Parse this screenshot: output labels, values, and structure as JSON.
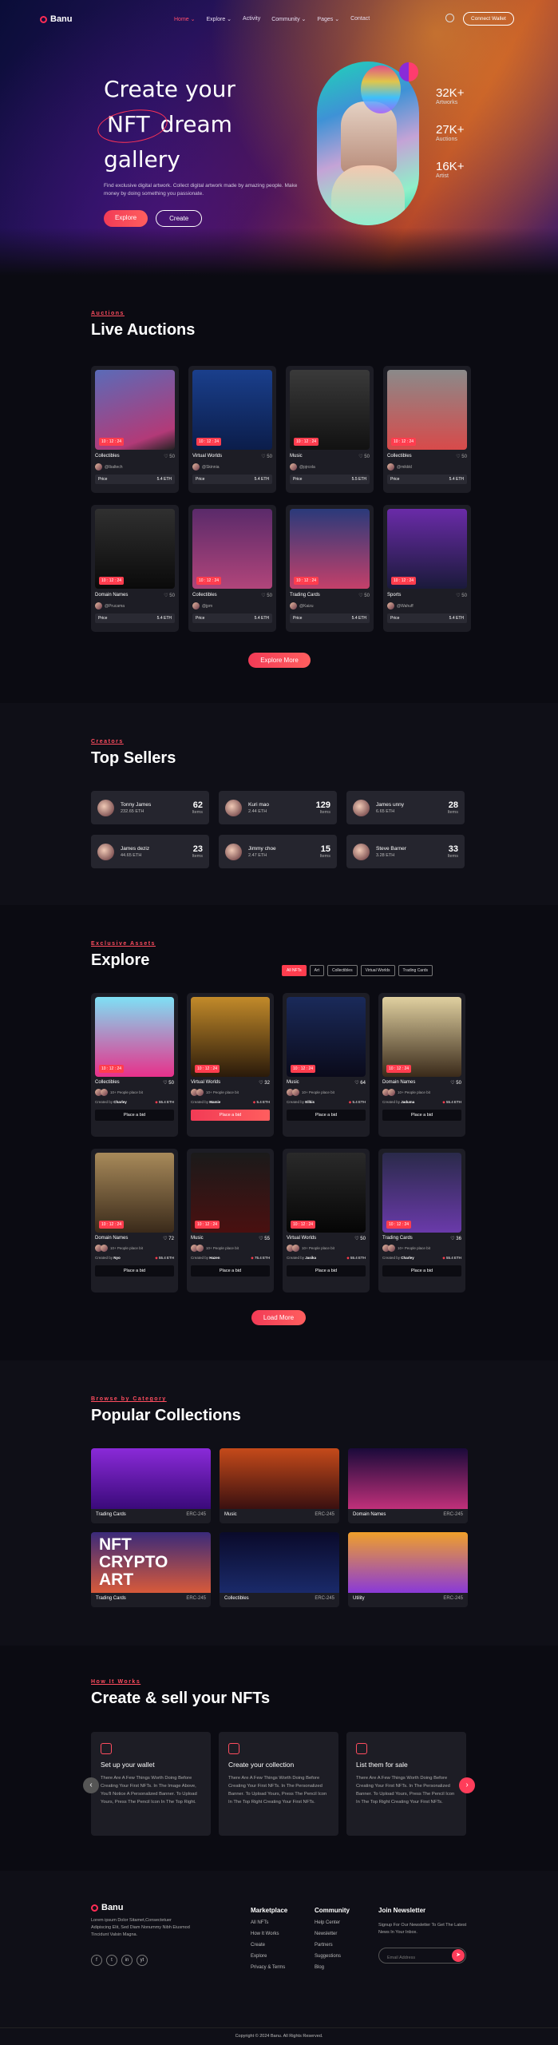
{
  "header": {
    "brand": "Banu",
    "nav": [
      "Home ⌄",
      "Explore ⌄",
      "Activity",
      "Community ⌄",
      "Pages ⌄",
      "Contact"
    ],
    "wallet": "Connect Wallet"
  },
  "hero": {
    "title_1": "Create your",
    "title_2a": "NFT",
    "title_2b": "dream",
    "title_3": "gallery",
    "desc": "Find exclusive digital artwork. Collect digital artwork made by amazing people. Make money by doing something you passionate.",
    "btn_explore": "Explore",
    "btn_create": "Create",
    "stats": [
      {
        "n": "32K+",
        "l": "Artworks"
      },
      {
        "n": "27K+",
        "l": "Auctions"
      },
      {
        "n": "16K+",
        "l": "Artist"
      }
    ]
  },
  "auctions": {
    "kicker": "Auctions",
    "title": "Live Auctions",
    "price_label": "Price",
    "cta": "Explore More",
    "items": [
      {
        "cat": "Collectibles",
        "likes": "♡ 50",
        "owner": "@Ibaltech",
        "price": "5.4 ETH",
        "timer": "10 : 12 : 24"
      },
      {
        "cat": "Virtual Worlds",
        "likes": "♡ 50",
        "owner": "@Skinnia",
        "price": "5.4 ETH",
        "timer": "10 : 12 : 24"
      },
      {
        "cat": "Music",
        "likes": "♡ 50",
        "owner": "@pjrcola",
        "price": "5.5 ETH",
        "timer": "10 : 12 : 24"
      },
      {
        "cat": "Collectibles",
        "likes": "♡ 50",
        "owner": "@mikkkl",
        "price": "5.4 ETH",
        "timer": "10 : 12 : 24"
      },
      {
        "cat": "Domain Names",
        "likes": "♡ 50",
        "owner": "@Prucama",
        "price": "5.4 ETH",
        "timer": "10 : 12 : 24"
      },
      {
        "cat": "Collectibles",
        "likes": "♡ 50",
        "owner": "@jpm",
        "price": "5.4 ETH",
        "timer": "10 : 12 : 24"
      },
      {
        "cat": "Trading Cards",
        "likes": "♡ 50",
        "owner": "@Kaizu",
        "price": "5.4 ETH",
        "timer": "10 : 12 : 24"
      },
      {
        "cat": "Sports",
        "likes": "♡ 50",
        "owner": "@Wahuff",
        "price": "5.4 ETH",
        "timer": "10 : 12 : 24"
      }
    ]
  },
  "sellers": {
    "kicker": "Creators",
    "title": "Top Sellers",
    "items_label": "Items",
    "items": [
      {
        "name": "Tonny James",
        "eth": "232.65 ETH",
        "count": "62"
      },
      {
        "name": "Kuri mao",
        "eth": "2.44 ETH",
        "count": "129"
      },
      {
        "name": "James unny",
        "eth": "6.65 ETH",
        "count": "28"
      },
      {
        "name": "James deziz",
        "eth": "44.65 ETH",
        "count": "23"
      },
      {
        "name": "Jimmy choe",
        "eth": "2.47 ETH",
        "count": "15"
      },
      {
        "name": "Steve Barner",
        "eth": "3.28 ETH",
        "count": "33"
      }
    ]
  },
  "explore": {
    "kicker": "Exclusive Assets",
    "title": "Explore",
    "tabs": [
      "All NFTs",
      "Art",
      "Collectibles",
      "Virtual Worlds",
      "Trading Cards"
    ],
    "people": "10+ People place bit",
    "created_by": "Created by",
    "bid": "Place a bid",
    "cta": "Load More",
    "items": [
      {
        "cat": "Collectibles",
        "likes": "♡ 50",
        "creator": "Charley",
        "price": "55.4 ETH",
        "timer": "10 : 12 : 24"
      },
      {
        "cat": "Virtual Worlds",
        "likes": "♡ 32",
        "creator": "Mamie",
        "price": "5.4 ETH",
        "timer": "10 : 12 : 24"
      },
      {
        "cat": "Music",
        "likes": "♡ 64",
        "creator": "Ellkis",
        "price": "5.4 ETH",
        "timer": "10 : 12 : 24"
      },
      {
        "cat": "Domain Names",
        "likes": "♡ 50",
        "creator": "Jaduma",
        "price": "55.4 ETH",
        "timer": "10 : 12 : 24"
      },
      {
        "cat": "Domain Names",
        "likes": "♡ 72",
        "creator": "Nyo",
        "price": "55.4 ETH",
        "timer": "10 : 12 : 24"
      },
      {
        "cat": "Music",
        "likes": "♡ 55",
        "creator": "Hazen",
        "price": "75.4 ETH",
        "timer": "10 : 12 : 24"
      },
      {
        "cat": "Virtual Worlds",
        "likes": "♡ 50",
        "creator": "Jasika",
        "price": "55.4 ETH",
        "timer": "10 : 12 : 24"
      },
      {
        "cat": "Trading Cards",
        "likes": "♡ 36",
        "creator": "Charley",
        "price": "55.4 ETH",
        "timer": "10 : 12 : 24"
      }
    ]
  },
  "collections": {
    "kicker": "Browse by Category",
    "title": "Popular Collections",
    "nft_text": "NFT CRYPTO ART",
    "items": [
      {
        "name": "Trading Cards",
        "count": "ERC-245"
      },
      {
        "name": "Music",
        "count": "ERC-245"
      },
      {
        "name": "Domain Names",
        "count": "ERC-245"
      },
      {
        "name": "Trading Cards",
        "count": "ERC-245"
      },
      {
        "name": "Collectibles",
        "count": "ERC-245"
      },
      {
        "name": "Utility",
        "count": "ERC-245"
      }
    ]
  },
  "how": {
    "kicker": "How It Works",
    "title": "Create & sell your NFTs",
    "items": [
      {
        "title": "Set up your wallet",
        "text": "There Are A Few Things Worth Doing Before Creating Your First NFTs. In The Image Above, You'll Notice A Personalized Banner. To Upload Yours, Press The Pencil Icon In The Top Right."
      },
      {
        "title": "Create your collection",
        "text": "There Are A Few Things Worth Doing Before Creating Your First NFTs. In The Personalized Banner. To Upload Yours, Press The Pencil Icon In The Top Right Creating Your First NFTs."
      },
      {
        "title": "List them for sale",
        "text": "There Are A Few Things Worth Doing Before Creating Your First NFTs. In The Personalized Banner. To Upload Yours, Press The Pencil Icon In The Top Right Creating Your First NFTs."
      }
    ]
  },
  "footer": {
    "brand": "Banu",
    "about": "Lorem ipsum Dolor Sitamet,Consectetuer Adipiscing Elit, Sed Diam Nonummy Nibh Eiusmod Tincidunt Valsin Magna.",
    "socials": [
      "f",
      "t",
      "in",
      "yt"
    ],
    "cols": [
      {
        "title": "Marketplace",
        "links": [
          "All NFTs",
          "How It Works",
          "Create",
          "Explore",
          "Privacy & Terms"
        ]
      },
      {
        "title": "Community",
        "links": [
          "Help Center",
          "Newsletter",
          "Partners",
          "Suggestions",
          "Blog"
        ]
      }
    ],
    "newsletter": {
      "title": "Join Newsletter",
      "text": "Signup For Our Newsletter To Get The Latest News In Your Inbox.",
      "placeholder": "Email Address"
    },
    "copyright": "Copyright © 2024 Banu. All Rights Reserved."
  }
}
